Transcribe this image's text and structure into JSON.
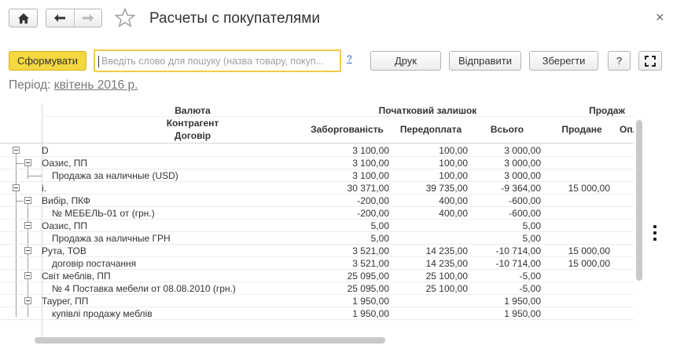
{
  "window": {
    "title": "Расчеты с покупателями"
  },
  "toolbar": {
    "generate_label": "Сформувати",
    "search_placeholder": "Введіть слово для пошуку (назва товару, покуп...",
    "help_link": "?",
    "print_label": "Друк",
    "send_label": "Відправити",
    "save_label": "Зберегти",
    "help_label": "?"
  },
  "period": {
    "label": "Період:",
    "value": "квітень 2016 р."
  },
  "report": {
    "header": {
      "group_col_line1": "Валюта",
      "group_col_line2": "Контрагент",
      "group_col_line3": "Договір",
      "opening_balance": "Початковий залишок",
      "sales": "Продаж",
      "debt": "Заборгованість",
      "prepayment": "Передоплата",
      "total": "Всього",
      "sold": "Продане",
      "paid_partial": "Опл"
    },
    "rows": [
      {
        "level": 0,
        "label": "D",
        "debt": "3 100,00",
        "prepay": "100,00",
        "total": "3 000,00",
        "sold": ""
      },
      {
        "level": 1,
        "label": "Оазис, ПП",
        "debt": "3 100,00",
        "prepay": "100,00",
        "total": "3 000,00",
        "sold": ""
      },
      {
        "level": 2,
        "label": "Продажа за наличные  (USD)",
        "debt": "3 100,00",
        "prepay": "100,00",
        "total": "3 000,00",
        "sold": ""
      },
      {
        "level": 0,
        "label": "і.",
        "debt": "30 371,00",
        "prepay": "39 735,00",
        "total": "-9 364,00",
        "sold": "15 000,00"
      },
      {
        "level": 1,
        "label": "Вибір, ПКФ",
        "debt": "-200,00",
        "prepay": "400,00",
        "total": "-600,00",
        "sold": ""
      },
      {
        "level": 2,
        "label": "№ МЕБЕЛЬ-01 от  (грн.)",
        "debt": "-200,00",
        "prepay": "400,00",
        "total": "-600,00",
        "sold": ""
      },
      {
        "level": 1,
        "label": "Оазис, ПП",
        "debt": "5,00",
        "prepay": "",
        "total": "5,00",
        "sold": ""
      },
      {
        "level": 2,
        "label": "Продажа за наличные ГРН",
        "debt": "5,00",
        "prepay": "",
        "total": "5,00",
        "sold": ""
      },
      {
        "level": 1,
        "label": "Рута, ТОВ",
        "debt": "3 521,00",
        "prepay": "14 235,00",
        "total": "-10 714,00",
        "sold": "15 000,00"
      },
      {
        "level": 2,
        "label": "договір постачання",
        "debt": "3 521,00",
        "prepay": "14 235,00",
        "total": "-10 714,00",
        "sold": "15 000,00"
      },
      {
        "level": 1,
        "label": "Світ меблів, ПП",
        "debt": "25 095,00",
        "prepay": "25 100,00",
        "total": "-5,00",
        "sold": ""
      },
      {
        "level": 2,
        "label": "№ 4 Поставка мебели от 08.08.2010 (грн.)",
        "debt": "25 095,00",
        "prepay": "25 100,00",
        "total": "-5,00",
        "sold": ""
      },
      {
        "level": 1,
        "label": "Таурег, ПП",
        "debt": "1 950,00",
        "prepay": "",
        "total": "1 950,00",
        "sold": ""
      },
      {
        "level": 2,
        "label": "купівлі продажу меблів",
        "debt": "1 950,00",
        "prepay": "",
        "total": "1 950,00",
        "sold": ""
      }
    ]
  },
  "icons": {
    "home": "home-icon",
    "back": "arrow-left-icon",
    "forward": "arrow-right-icon",
    "favorite": "star-icon",
    "close": "close-icon",
    "fullscreen": "fullscreen-icon",
    "more": "kebab-icon"
  }
}
